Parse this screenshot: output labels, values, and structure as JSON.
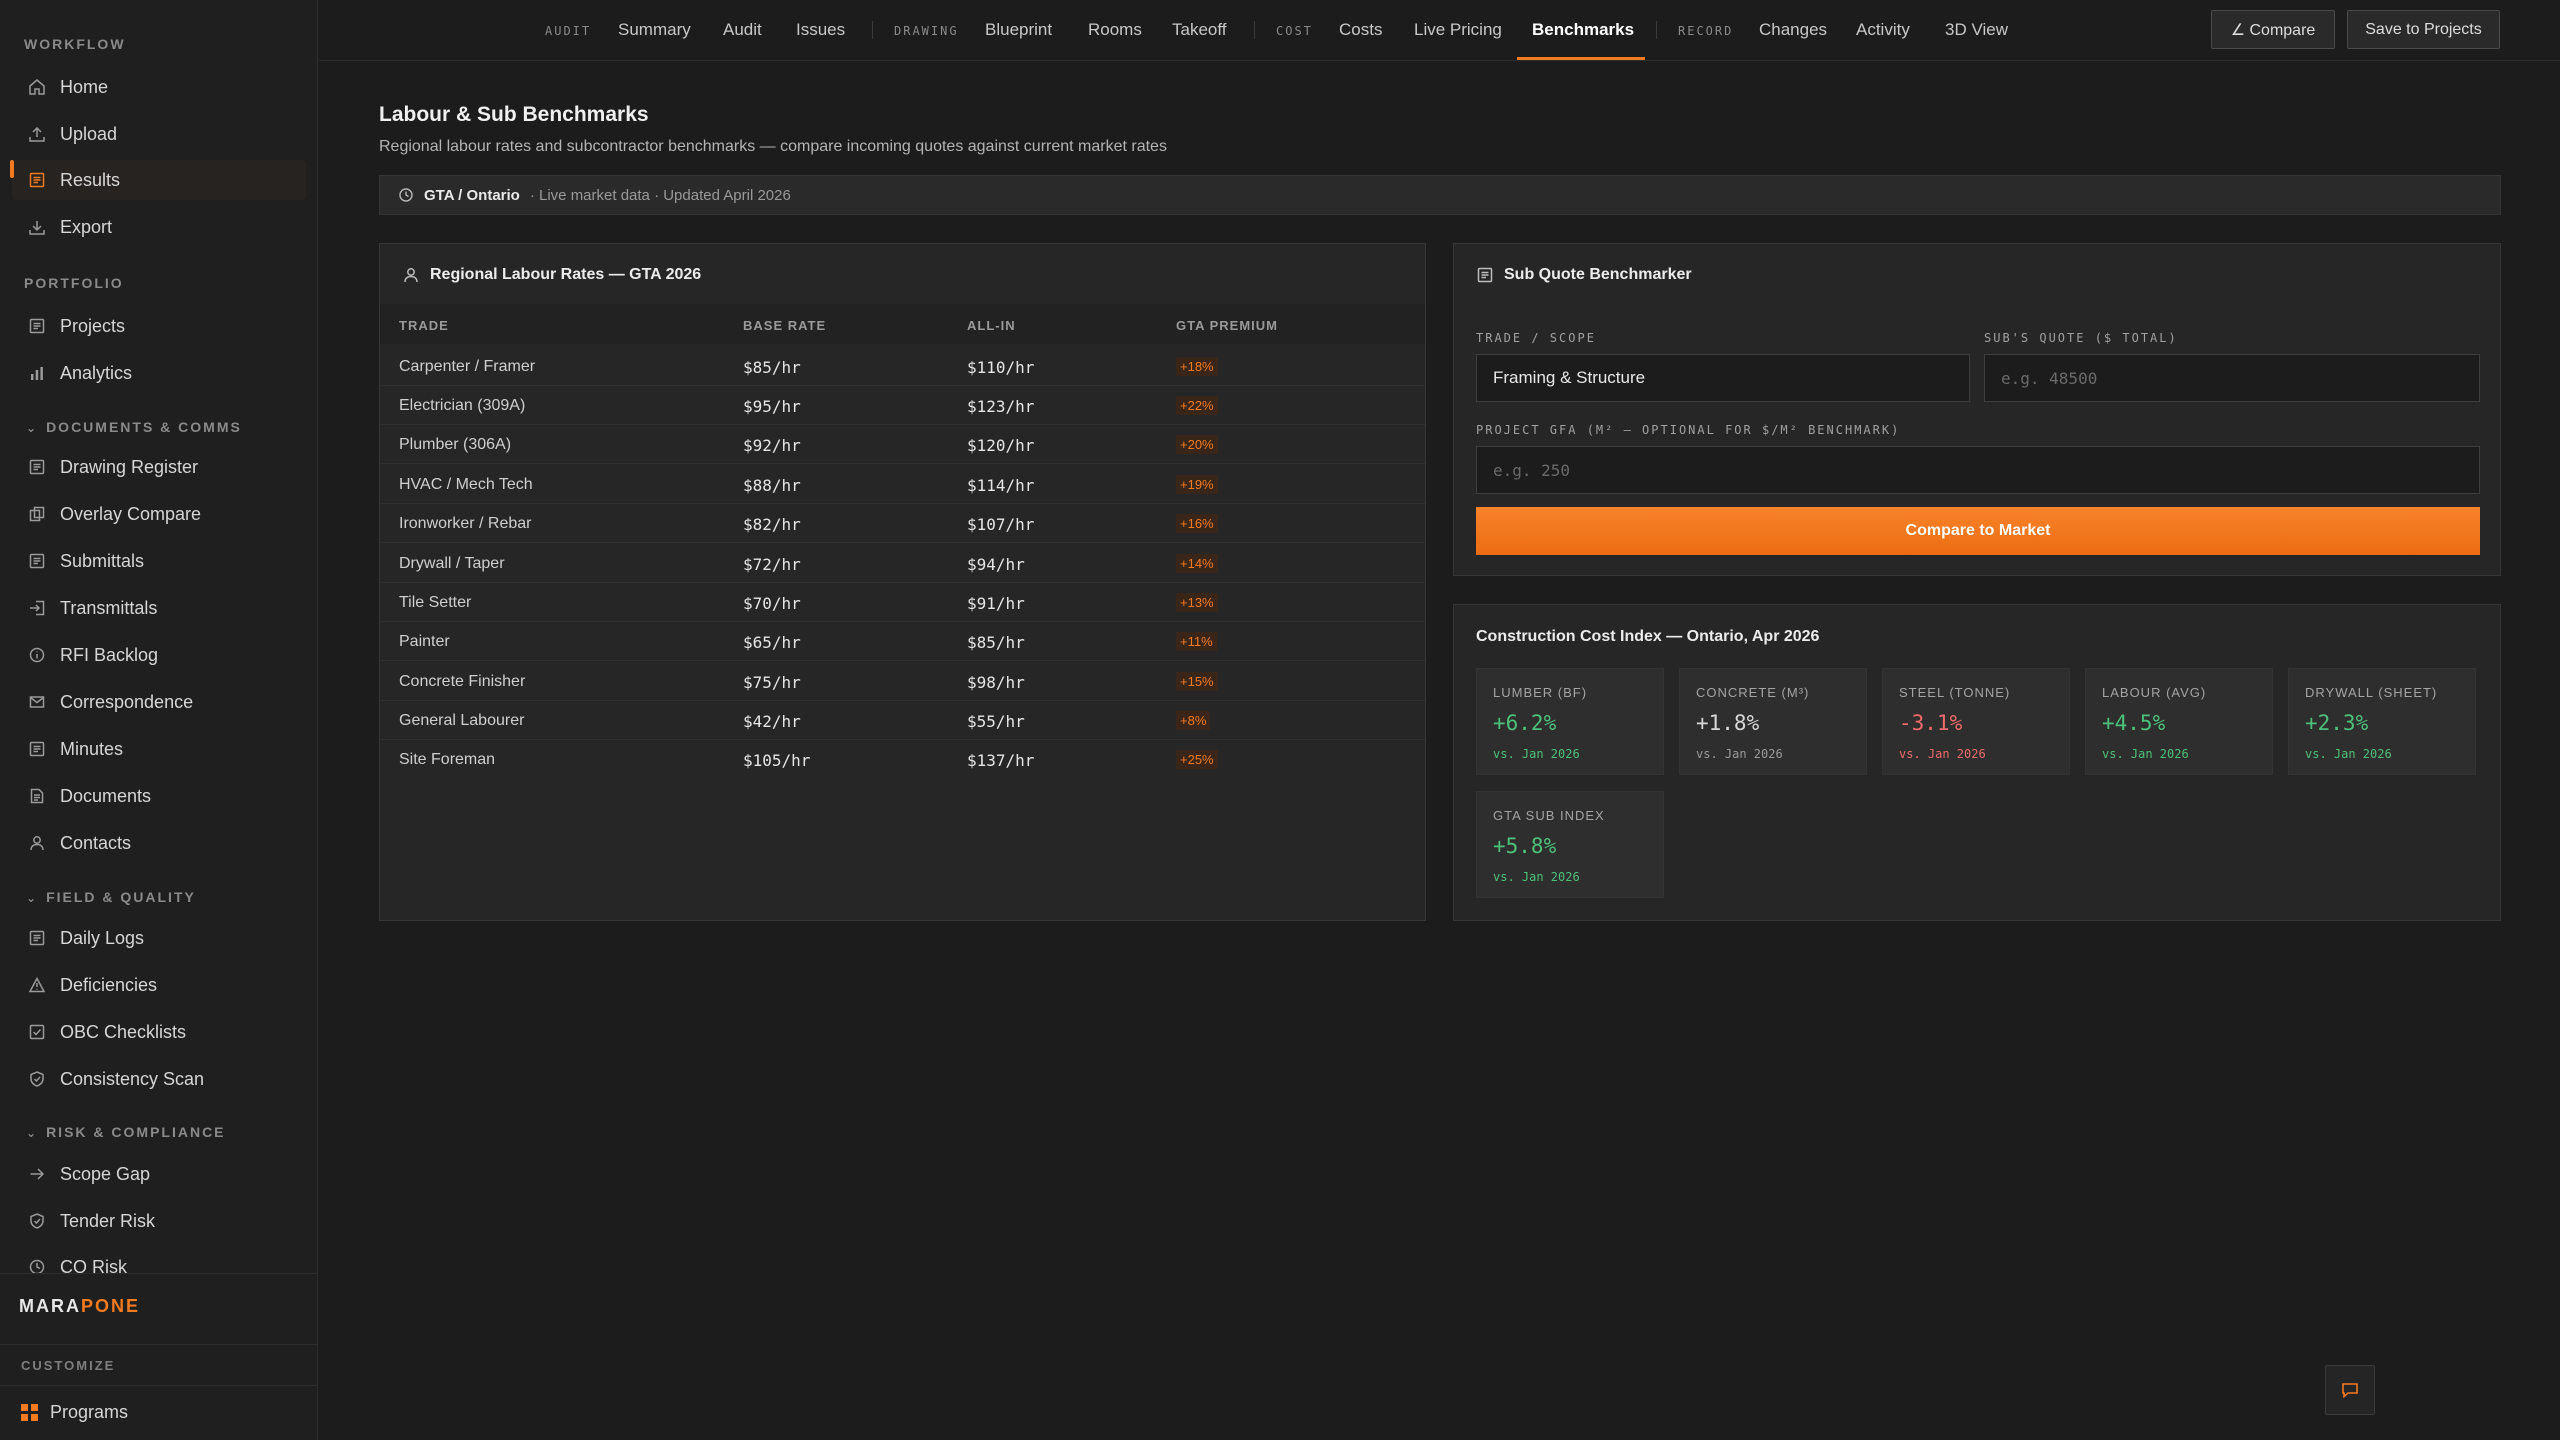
{
  "colors": {
    "accent": "#f47a1f",
    "positive": "#4cc17a",
    "negative": "#f06a6a",
    "neutral": "#d8d8d8"
  },
  "sidebar": {
    "sections": {
      "workflow": "WORKFLOW",
      "portfolio": "PORTFOLIO",
      "documents": "DOCUMENTS & COMMS",
      "field": "FIELD & QUALITY",
      "risk": "RISK & COMPLIANCE"
    },
    "items": {
      "home": {
        "label": "Home",
        "icon": "home-icon"
      },
      "upload": {
        "label": "Upload",
        "icon": "upload-icon"
      },
      "results": {
        "label": "Results",
        "icon": "results-icon",
        "active": true
      },
      "export": {
        "label": "Export",
        "icon": "export-icon"
      },
      "projects": {
        "label": "Projects",
        "icon": "document-icon"
      },
      "analytics": {
        "label": "Analytics",
        "icon": "bar-chart-icon"
      },
      "drawing_register": {
        "label": "Drawing Register",
        "icon": "document-icon"
      },
      "overlay_compare": {
        "label": "Overlay Compare",
        "icon": "overlay-icon"
      },
      "submittals": {
        "label": "Submittals",
        "icon": "document-icon"
      },
      "transmittals": {
        "label": "Transmittals",
        "icon": "transmit-icon"
      },
      "rfi_backlog": {
        "label": "RFI Backlog",
        "icon": "info-icon"
      },
      "correspondence": {
        "label": "Correspondence",
        "icon": "mail-icon"
      },
      "minutes": {
        "label": "Minutes",
        "icon": "document-icon"
      },
      "documents": {
        "label": "Documents",
        "icon": "file-icon"
      },
      "contacts": {
        "label": "Contacts",
        "icon": "user-icon"
      },
      "daily_logs": {
        "label": "Daily Logs",
        "icon": "document-icon"
      },
      "deficiencies": {
        "label": "Deficiencies",
        "icon": "warning-icon"
      },
      "obc_checklists": {
        "label": "OBC Checklists",
        "icon": "checklist-icon"
      },
      "consistency_scan": {
        "label": "Consistency Scan",
        "icon": "shield-check-icon"
      },
      "scope_gap": {
        "label": "Scope Gap",
        "icon": "arrow-right-icon"
      },
      "tender_risk": {
        "label": "Tender Risk",
        "icon": "shield-check-icon"
      },
      "co_risk": {
        "label": "CO Risk",
        "icon": "clock-icon"
      }
    },
    "brand_left": "MARA",
    "brand_right": "PONE",
    "customize": "CUSTOMIZE",
    "programs": "Programs"
  },
  "topbar": {
    "groups": {
      "audit": "AUDIT",
      "drawing": "DRAWING",
      "cost": "COST",
      "record": "RECORD"
    },
    "tabs": {
      "summary": "Summary",
      "audit": "Audit",
      "issues": "Issues",
      "blueprint": "Blueprint",
      "rooms": "Rooms",
      "takeoff": "Takeoff",
      "costs": "Costs",
      "live_pricing": "Live Pricing",
      "benchmarks": "Benchmarks",
      "changes": "Changes",
      "activity": "Activity",
      "view3d": "3D View"
    },
    "active_tab": "benchmarks",
    "compare_label": "∠ Compare",
    "save_label": "Save to Projects"
  },
  "page": {
    "title": "Labour & Sub Benchmarks",
    "subtitle": "Regional labour rates and subcontractor benchmarks — compare incoming quotes against current market rates",
    "region": "GTA / Ontario",
    "meta": "· Live market data · Updated April 2026"
  },
  "labour": {
    "title": "Regional Labour Rates — GTA 2026",
    "headers": {
      "trade": "TRADE",
      "base": "BASE RATE",
      "allin": "ALL-IN",
      "premium": "GTA PREMIUM"
    },
    "rows": [
      {
        "trade": "Carpenter / Framer",
        "base": "$85/hr",
        "allin": "$110/hr",
        "premium": "+18%"
      },
      {
        "trade": "Electrician (309A)",
        "base": "$95/hr",
        "allin": "$123/hr",
        "premium": "+22%"
      },
      {
        "trade": "Plumber (306A)",
        "base": "$92/hr",
        "allin": "$120/hr",
        "premium": "+20%"
      },
      {
        "trade": "HVAC / Mech Tech",
        "base": "$88/hr",
        "allin": "$114/hr",
        "premium": "+19%"
      },
      {
        "trade": "Ironworker / Rebar",
        "base": "$82/hr",
        "allin": "$107/hr",
        "premium": "+16%"
      },
      {
        "trade": "Drywall / Taper",
        "base": "$72/hr",
        "allin": "$94/hr",
        "premium": "+14%"
      },
      {
        "trade": "Tile Setter",
        "base": "$70/hr",
        "allin": "$91/hr",
        "premium": "+13%"
      },
      {
        "trade": "Painter",
        "base": "$65/hr",
        "allin": "$85/hr",
        "premium": "+11%"
      },
      {
        "trade": "Concrete Finisher",
        "base": "$75/hr",
        "allin": "$98/hr",
        "premium": "+15%"
      },
      {
        "trade": "General Labourer",
        "base": "$42/hr",
        "allin": "$55/hr",
        "premium": "+8%"
      },
      {
        "trade": "Site Foreman",
        "base": "$105/hr",
        "allin": "$137/hr",
        "premium": "+25%"
      }
    ]
  },
  "sub_quote": {
    "title": "Sub Quote Benchmarker",
    "trade_label": "TRADE / SCOPE",
    "trade_value": "Framing & Structure",
    "quote_label": "SUB'S QUOTE ($ TOTAL)",
    "quote_placeholder": "e.g. 48500",
    "gfa_label": "PROJECT GFA (M² — OPTIONAL FOR $/M² BENCHMARK)",
    "gfa_placeholder": "e.g. 250",
    "button": "Compare to Market"
  },
  "cost_index": {
    "title": "Construction Cost Index — Ontario, Apr 2026",
    "tiles": [
      {
        "label": "LUMBER (BF)",
        "value": "+6.2%",
        "sub": "vs. Jan 2026",
        "trend": "up"
      },
      {
        "label": "CONCRETE (M³)",
        "value": "+1.8%",
        "sub": "vs. Jan 2026",
        "trend": "neutral"
      },
      {
        "label": "STEEL (TONNE)",
        "value": "-3.1%",
        "sub": "vs. Jan 2026",
        "trend": "down"
      },
      {
        "label": "LABOUR (AVG)",
        "value": "+4.5%",
        "sub": "vs. Jan 2026",
        "trend": "up"
      },
      {
        "label": "DRYWALL (SHEET)",
        "value": "+2.3%",
        "sub": "vs. Jan 2026",
        "trend": "up"
      },
      {
        "label": "GTA SUB INDEX",
        "value": "+5.8%",
        "sub": "vs. Jan 2026",
        "trend": "up"
      }
    ]
  },
  "chat": {
    "icon": "chat-icon"
  }
}
